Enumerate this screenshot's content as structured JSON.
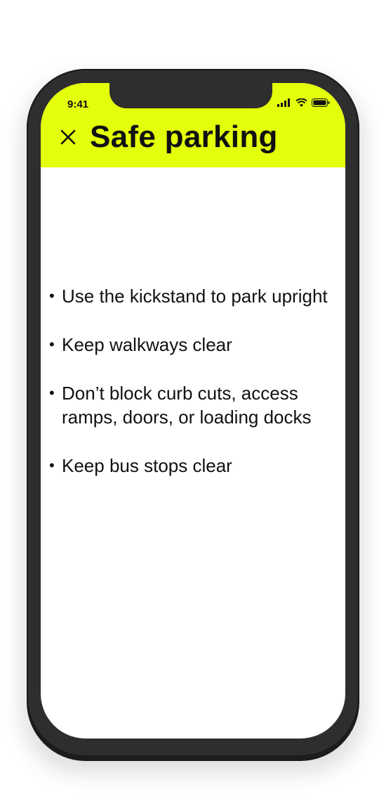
{
  "status_bar": {
    "time": "9:41",
    "icons": [
      "signal-icon",
      "wifi-icon",
      "battery-icon"
    ]
  },
  "header": {
    "title": "Safe parking",
    "close_icon": "close-icon",
    "background_color": "#e4ff0b"
  },
  "guidelines": [
    {
      "bullet": "•",
      "text": "Use the kickstand to park upright"
    },
    {
      "bullet": "•",
      "text": "Keep walkways clear"
    },
    {
      "bullet": "•",
      "text": "Don’t block curb cuts, access ramps, doors, or loading docks"
    },
    {
      "bullet": "•",
      "text": "Keep bus stops clear"
    }
  ]
}
